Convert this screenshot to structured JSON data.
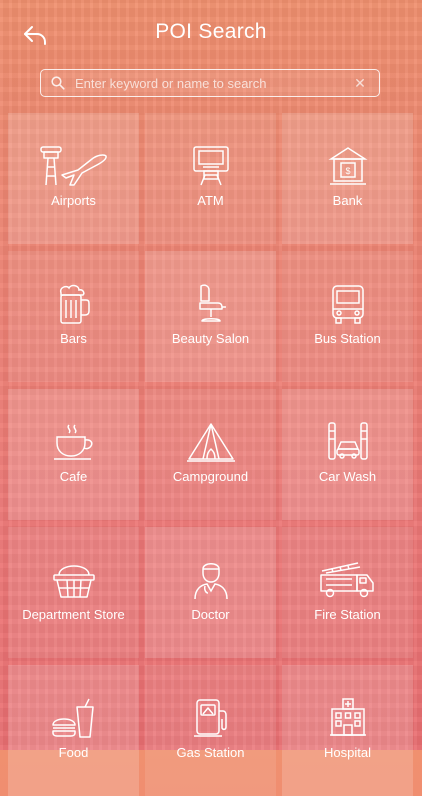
{
  "header": {
    "title": "POI Search",
    "back_icon": "back-arrow-icon"
  },
  "search": {
    "placeholder": "Enter keyword or name to search",
    "value": "",
    "icon": "search-icon",
    "clear_icon": "clear-icon"
  },
  "categories": [
    {
      "label": "Airports",
      "icon": "airport-icon"
    },
    {
      "label": "ATM",
      "icon": "atm-icon"
    },
    {
      "label": "Bank",
      "icon": "bank-icon"
    },
    {
      "label": "Bars",
      "icon": "beer-mug-icon"
    },
    {
      "label": "Beauty Salon",
      "icon": "salon-chair-icon"
    },
    {
      "label": "Bus Station",
      "icon": "bus-icon"
    },
    {
      "label": "Cafe",
      "icon": "coffee-cup-icon"
    },
    {
      "label": "Campground",
      "icon": "tent-icon"
    },
    {
      "label": "Car Wash",
      "icon": "car-wash-icon"
    },
    {
      "label": "Department Store",
      "icon": "shopping-basket-icon"
    },
    {
      "label": "Doctor",
      "icon": "doctor-icon"
    },
    {
      "label": "Fire Station",
      "icon": "fire-truck-icon"
    },
    {
      "label": "Food",
      "icon": "food-icon"
    },
    {
      "label": "Gas Station",
      "icon": "fuel-pump-icon"
    },
    {
      "label": "Hospital",
      "icon": "hospital-icon"
    }
  ],
  "colors": {
    "background_top": "#f0906f",
    "background_bottom": "#e96f72",
    "foreground": "#ffffff"
  }
}
